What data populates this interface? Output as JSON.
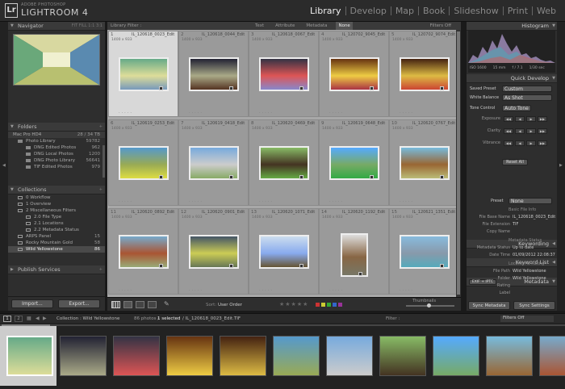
{
  "app": {
    "brand_small": "ADOBE PHOTOSHOP",
    "brand_big": "LIGHTROOM 4",
    "logo": "Lr"
  },
  "modules": [
    "Library",
    "Develop",
    "Map",
    "Book",
    "Slideshow",
    "Print",
    "Web"
  ],
  "active_module": "Library",
  "navigator": {
    "title": "Navigator",
    "zoom_options": "FIT  FILL  1:1  3:1"
  },
  "folders": {
    "title": "Folders",
    "drive": {
      "name": "Mac Pro HD4",
      "size": "28 / 34 TB"
    },
    "items": [
      {
        "label": "Photo Library",
        "count": "59782"
      },
      {
        "label": "DNG Edited Photos",
        "count": "962"
      },
      {
        "label": "DNG Local Photos",
        "count": "1200"
      },
      {
        "label": "DNG Photo Library",
        "count": "56641"
      },
      {
        "label": "TIF Edited Photos",
        "count": "979"
      }
    ]
  },
  "collections": {
    "title": "Collections",
    "items": [
      {
        "label": "0 Workflow",
        "count": ""
      },
      {
        "label": "1 Overview",
        "count": ""
      },
      {
        "label": "2 Miscellaneous Filters",
        "count": ""
      },
      {
        "label": "2.0 File Type",
        "count": ""
      },
      {
        "label": "2.1 Locations",
        "count": ""
      },
      {
        "label": "2.2 Metadata Status",
        "count": ""
      },
      {
        "label": "ARPS Panel",
        "count": "15"
      },
      {
        "label": "Rocky Mountain Gold",
        "count": "58"
      },
      {
        "label": "Wild Yellowstone",
        "count": "86"
      }
    ]
  },
  "publish": {
    "title": "Publish Services"
  },
  "left_buttons": {
    "import": "Import...",
    "export": "Export..."
  },
  "library_filter": {
    "title": "Library Filter :",
    "tabs": [
      "Text",
      "Attribute",
      "Metadata",
      "None"
    ],
    "active": "None",
    "status": "Filters Off"
  },
  "grid": [
    {
      "num": "1",
      "name": "IL_120618_0023_Edit",
      "dims": "1400 x 933",
      "colors": [
        "#6a8",
        "#dd9",
        "#79b"
      ]
    },
    {
      "num": "2",
      "name": "IL_120618_0044_Edit",
      "dims": "1400 x 933",
      "colors": [
        "#223",
        "#aa8",
        "#532"
      ]
    },
    {
      "num": "3",
      "name": "IL_120618_0067_Edit",
      "dims": "1400 x 933",
      "colors": [
        "#334",
        "#d55",
        "#88c"
      ]
    },
    {
      "num": "4",
      "name": "IL_120702_9045_Edit",
      "dims": "1400 x 933",
      "colors": [
        "#631",
        "#ec4",
        "#a34"
      ]
    },
    {
      "num": "5",
      "name": "IL_120702_9074_Edit",
      "dims": "1400 x 933",
      "colors": [
        "#421",
        "#db4",
        "#c43"
      ]
    },
    {
      "num": "6",
      "name": "IL_120619_0253_Edit",
      "dims": "1400 x 933",
      "colors": [
        "#59c",
        "#9a5",
        "#dd4"
      ]
    },
    {
      "num": "7",
      "name": "IL_120619_0418_Edit",
      "dims": "1400 x 933",
      "colors": [
        "#7ad",
        "#ccc",
        "#8a6"
      ]
    },
    {
      "num": "8",
      "name": "IL_120620_0469_Edit",
      "dims": "1400 x 933",
      "colors": [
        "#8b6",
        "#432",
        "#6a4"
      ]
    },
    {
      "num": "9",
      "name": "IL_120619_0648_Edit",
      "dims": "1400 x 933",
      "colors": [
        "#5af",
        "#7a6",
        "#3a4"
      ]
    },
    {
      "num": "10",
      "name": "IL_120620_0767_Edit",
      "dims": "1400 x 933",
      "colors": [
        "#7bd",
        "#963",
        "#bb7"
      ]
    },
    {
      "num": "11",
      "name": "IL_120620_0892_Edit",
      "dims": "1400 x 933",
      "colors": [
        "#7ac",
        "#a53",
        "#9a7"
      ]
    },
    {
      "num": "12",
      "name": "IL_120620_0901_Edit",
      "dims": "1400 x 933",
      "colors": [
        "#456",
        "#cc5",
        "#675"
      ]
    },
    {
      "num": "13",
      "name": "IL_120620_1071_Edit",
      "dims": "1400 x 933",
      "colors": [
        "#cde",
        "#8ae",
        "#653"
      ]
    },
    {
      "num": "14",
      "name": "IL_120620_1192_Edit",
      "dims": "1400 x 933",
      "colors": [
        "#ddd",
        "#864",
        "#776"
      ]
    },
    {
      "num": "15",
      "name": "IL_120621_1351_Edit",
      "dims": "1400 x 933",
      "colors": [
        "#8bd",
        "#89a",
        "#5ab"
      ]
    }
  ],
  "toolbar": {
    "sort_label": "Sort:",
    "sort_value": "User Order",
    "thumb_label": "Thumbnails"
  },
  "histogram": {
    "title": "Histogram",
    "info": [
      "ISO 1600",
      "15 mm",
      "f / 7.1",
      "1/30 sec"
    ]
  },
  "quick_develop": {
    "title": "Quick Develop",
    "saved_preset_label": "Saved Preset",
    "saved_preset": "Custom",
    "wb_label": "White Balance",
    "wb": "As Shot",
    "tone_label": "Tone Control",
    "tone_btn": "Auto Tone",
    "rows": [
      "Exposure",
      "Clarity",
      "Vibrance"
    ],
    "reset": "Reset All"
  },
  "keywording": {
    "title": "Keywording"
  },
  "keyword_list": {
    "title": "Keyword List"
  },
  "metadata": {
    "title": "Metadata",
    "set": "EXIF + IPTC",
    "preset_label": "Preset",
    "preset": "None",
    "section1": "Basic File Info",
    "rows1": [
      {
        "k": "File Base Name",
        "v": "IL_120618_0023_Edit"
      },
      {
        "k": "File Extension",
        "v": "TIF"
      },
      {
        "k": "Copy Name",
        "v": ""
      }
    ],
    "section2": "Metadata Status",
    "rows2": [
      {
        "k": "Metadata Status",
        "v": "Up to date"
      },
      {
        "k": "Date Time",
        "v": "01/09/2012 22:08:37"
      }
    ],
    "section3": "Location & Rating",
    "rows3": [
      {
        "k": "File Path",
        "v": "Wild Yellowstone"
      },
      {
        "k": "Folder",
        "v": "Wild Yellowstone"
      },
      {
        "k": "Rating",
        "v": ""
      },
      {
        "k": "Label",
        "v": ""
      }
    ]
  },
  "sync": {
    "metadata": "Sync Metadata",
    "settings": "Sync Settings"
  },
  "filmstrip": {
    "pages": [
      "1",
      "2"
    ],
    "source": "Collection : Wild Yellowstone",
    "count": "86 photos /",
    "selected": "1 selected",
    "file": "/ IL_120618_0023_Edit.TIF",
    "filter_label": "Filter :",
    "filter_value": "Filters Off",
    "thumbs": [
      [
        "#6a8",
        "#dd9"
      ],
      [
        "#223",
        "#aa8"
      ],
      [
        "#334",
        "#d55"
      ],
      [
        "#631",
        "#ec4"
      ],
      [
        "#421",
        "#db4"
      ],
      [
        "#59c",
        "#9a5"
      ],
      [
        "#7ad",
        "#ccc"
      ],
      [
        "#8b6",
        "#432"
      ],
      [
        "#5af",
        "#7a6"
      ],
      [
        "#7bd",
        "#963"
      ],
      [
        "#7ac",
        "#a53"
      ]
    ]
  },
  "colors": {
    "accent_label": "Wild Yellowstone",
    "bg": "#2e2e2e",
    "grid_bg": "#a8a8a8"
  }
}
